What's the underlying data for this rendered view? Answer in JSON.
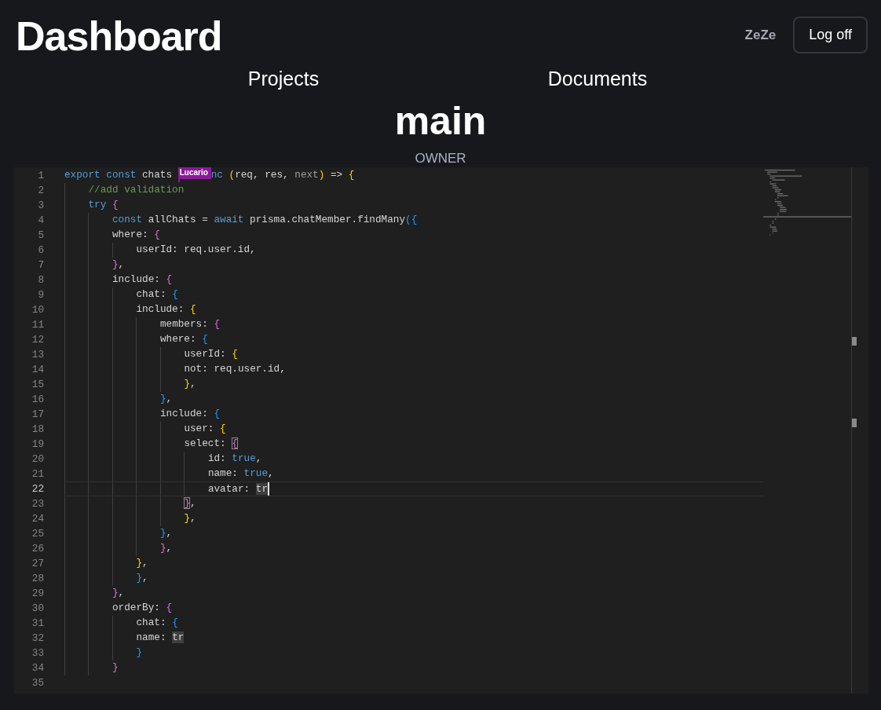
{
  "header": {
    "title": "Dashboard",
    "user": "ZeZe",
    "logout_button": "Log off"
  },
  "nav": [
    {
      "label": "Projects"
    },
    {
      "label": "Documents"
    }
  ],
  "project": {
    "name": "main",
    "role": "OWNER"
  },
  "editor": {
    "lines": [
      {
        "number": "1",
        "current": false,
        "tokens": [
          {
            "text": "export const",
            "kind": "keyword"
          },
          {
            "text": " chats ",
            "kind": "plain"
          },
          {
            "label": "Lucario",
            "kind": "flag"
          },
          {
            "text": "nc ",
            "kind": "keyword"
          },
          {
            "text": "(",
            "kind": "b1"
          },
          {
            "text": "req, res, ",
            "kind": "plain"
          },
          {
            "text": "next",
            "kind": "dim"
          },
          {
            "text": ")",
            "kind": "b1"
          },
          {
            "text": " => ",
            "kind": "plain"
          },
          {
            "text": "{",
            "kind": "b1"
          }
        ]
      },
      {
        "number": "2",
        "current": false,
        "tokens": [
          {
            "text": "    //add validation",
            "kind": "comment"
          }
        ]
      },
      {
        "number": "3",
        "current": false,
        "tokens": [
          {
            "text": "    try ",
            "kind": "keyword"
          },
          {
            "text": "{",
            "kind": "b2"
          }
        ]
      },
      {
        "number": "4",
        "current": false,
        "tokens": [
          {
            "text": "        const",
            "kind": "keyword"
          },
          {
            "text": " allChats = ",
            "kind": "plain"
          },
          {
            "text": "await",
            "kind": "keyword"
          },
          {
            "text": " prisma.chatMember.findMany",
            "kind": "plain"
          },
          {
            "text": "({",
            "kind": "b3"
          }
        ]
      },
      {
        "number": "5",
        "current": false,
        "tokens": [
          {
            "text": "        where: ",
            "kind": "plain"
          },
          {
            "text": "{",
            "kind": "b2"
          }
        ]
      },
      {
        "number": "6",
        "current": false,
        "tokens": [
          {
            "text": "            userId: req.user.id,",
            "kind": "plain"
          }
        ]
      },
      {
        "number": "7",
        "current": false,
        "tokens": [
          {
            "text": "        }",
            "kind": "b2"
          },
          {
            "text": ",",
            "kind": "plain"
          }
        ]
      },
      {
        "number": "8",
        "current": false,
        "tokens": [
          {
            "text": "        include: ",
            "kind": "plain"
          },
          {
            "text": "{",
            "kind": "b2"
          }
        ]
      },
      {
        "number": "9",
        "current": false,
        "tokens": [
          {
            "text": "            chat: ",
            "kind": "plain"
          },
          {
            "text": "{",
            "kind": "b3"
          }
        ]
      },
      {
        "number": "10",
        "current": false,
        "tokens": [
          {
            "text": "            include: ",
            "kind": "plain"
          },
          {
            "text": "{",
            "kind": "b1"
          }
        ]
      },
      {
        "number": "11",
        "current": false,
        "tokens": [
          {
            "text": "                members: ",
            "kind": "plain"
          },
          {
            "text": "{",
            "kind": "b2"
          }
        ]
      },
      {
        "number": "12",
        "current": false,
        "tokens": [
          {
            "text": "                where: ",
            "kind": "plain"
          },
          {
            "text": "{",
            "kind": "b3"
          }
        ]
      },
      {
        "number": "13",
        "current": false,
        "tokens": [
          {
            "text": "                    userId: ",
            "kind": "plain"
          },
          {
            "text": "{",
            "kind": "b1"
          }
        ]
      },
      {
        "number": "14",
        "current": false,
        "tokens": [
          {
            "text": "                    not: req.user.id,",
            "kind": "plain"
          }
        ]
      },
      {
        "number": "15",
        "current": false,
        "tokens": [
          {
            "text": "                    }",
            "kind": "b1"
          },
          {
            "text": ",",
            "kind": "plain"
          }
        ]
      },
      {
        "number": "16",
        "current": false,
        "tokens": [
          {
            "text": "                }",
            "kind": "b3"
          },
          {
            "text": ",",
            "kind": "plain"
          }
        ]
      },
      {
        "number": "17",
        "current": false,
        "tokens": [
          {
            "text": "                include: ",
            "kind": "plain"
          },
          {
            "text": "{",
            "kind": "b3"
          }
        ]
      },
      {
        "number": "18",
        "current": false,
        "tokens": [
          {
            "text": "                    user: ",
            "kind": "plain"
          },
          {
            "text": "{",
            "kind": "b1"
          }
        ]
      },
      {
        "number": "19",
        "current": false,
        "tokens": [
          {
            "text": "                    select: ",
            "kind": "plain"
          },
          {
            "text": "{",
            "kind": "match"
          }
        ]
      },
      {
        "number": "20",
        "current": false,
        "tokens": [
          {
            "text": "                        id: ",
            "kind": "plain"
          },
          {
            "text": "true",
            "kind": "keyword"
          },
          {
            "text": ",",
            "kind": "plain"
          }
        ]
      },
      {
        "number": "21",
        "current": false,
        "tokens": [
          {
            "text": "                        name: ",
            "kind": "plain"
          },
          {
            "text": "true",
            "kind": "keyword"
          },
          {
            "text": ",",
            "kind": "plain"
          }
        ]
      },
      {
        "number": "22",
        "current": true,
        "tokens": [
          {
            "text": "                        avatar: ",
            "kind": "plain"
          },
          {
            "text": "tr",
            "kind": "highlight"
          }
        ]
      },
      {
        "number": "23",
        "current": false,
        "tokens": [
          {
            "text": "                    }",
            "kind": "match"
          },
          {
            "text": ",",
            "kind": "plain"
          }
        ]
      },
      {
        "number": "24",
        "current": false,
        "tokens": [
          {
            "text": "                    }",
            "kind": "b1"
          },
          {
            "text": ",",
            "kind": "plain"
          }
        ]
      },
      {
        "number": "25",
        "current": false,
        "tokens": [
          {
            "text": "                }",
            "kind": "b3"
          },
          {
            "text": ",",
            "kind": "plain"
          }
        ]
      },
      {
        "number": "26",
        "current": false,
        "tokens": [
          {
            "text": "                }",
            "kind": "b2"
          },
          {
            "text": ",",
            "kind": "plain"
          }
        ]
      },
      {
        "number": "27",
        "current": false,
        "tokens": [
          {
            "text": "            }",
            "kind": "b1"
          },
          {
            "text": ",",
            "kind": "plain"
          }
        ]
      },
      {
        "number": "28",
        "current": false,
        "tokens": [
          {
            "text": "            }",
            "kind": "b3"
          },
          {
            "text": ",",
            "kind": "plain"
          }
        ]
      },
      {
        "number": "29",
        "current": false,
        "tokens": [
          {
            "text": "        }",
            "kind": "b2"
          },
          {
            "text": ",",
            "kind": "plain"
          }
        ]
      },
      {
        "number": "30",
        "current": false,
        "tokens": [
          {
            "text": "        orderBy: ",
            "kind": "plain"
          },
          {
            "text": "{",
            "kind": "b2"
          }
        ]
      },
      {
        "number": "31",
        "current": false,
        "tokens": [
          {
            "text": "            chat: ",
            "kind": "plain"
          },
          {
            "text": "{",
            "kind": "b3"
          }
        ]
      },
      {
        "number": "32",
        "current": false,
        "tokens": [
          {
            "text": "            name: ",
            "kind": "plain"
          },
          {
            "text": "tr",
            "kind": "highlight"
          }
        ]
      },
      {
        "number": "33",
        "current": false,
        "tokens": [
          {
            "text": "            }",
            "kind": "b3"
          }
        ]
      },
      {
        "number": "34",
        "current": false,
        "tokens": [
          {
            "text": "        }",
            "kind": "b2"
          }
        ]
      },
      {
        "number": "35",
        "current": false
      }
    ]
  }
}
